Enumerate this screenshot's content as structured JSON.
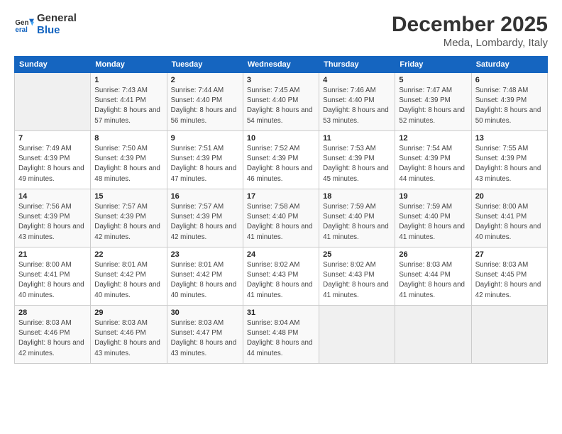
{
  "header": {
    "logo_general": "General",
    "logo_blue": "Blue",
    "month": "December 2025",
    "location": "Meda, Lombardy, Italy"
  },
  "weekdays": [
    "Sunday",
    "Monday",
    "Tuesday",
    "Wednesday",
    "Thursday",
    "Friday",
    "Saturday"
  ],
  "weeks": [
    [
      {
        "day": "",
        "empty": true
      },
      {
        "day": "1",
        "sunrise": "7:43 AM",
        "sunset": "4:41 PM",
        "daylight": "8 hours and 57 minutes."
      },
      {
        "day": "2",
        "sunrise": "7:44 AM",
        "sunset": "4:40 PM",
        "daylight": "8 hours and 56 minutes."
      },
      {
        "day": "3",
        "sunrise": "7:45 AM",
        "sunset": "4:40 PM",
        "daylight": "8 hours and 54 minutes."
      },
      {
        "day": "4",
        "sunrise": "7:46 AM",
        "sunset": "4:40 PM",
        "daylight": "8 hours and 53 minutes."
      },
      {
        "day": "5",
        "sunrise": "7:47 AM",
        "sunset": "4:39 PM",
        "daylight": "8 hours and 52 minutes."
      },
      {
        "day": "6",
        "sunrise": "7:48 AM",
        "sunset": "4:39 PM",
        "daylight": "8 hours and 50 minutes."
      }
    ],
    [
      {
        "day": "7",
        "sunrise": "7:49 AM",
        "sunset": "4:39 PM",
        "daylight": "8 hours and 49 minutes."
      },
      {
        "day": "8",
        "sunrise": "7:50 AM",
        "sunset": "4:39 PM",
        "daylight": "8 hours and 48 minutes."
      },
      {
        "day": "9",
        "sunrise": "7:51 AM",
        "sunset": "4:39 PM",
        "daylight": "8 hours and 47 minutes."
      },
      {
        "day": "10",
        "sunrise": "7:52 AM",
        "sunset": "4:39 PM",
        "daylight": "8 hours and 46 minutes."
      },
      {
        "day": "11",
        "sunrise": "7:53 AM",
        "sunset": "4:39 PM",
        "daylight": "8 hours and 45 minutes."
      },
      {
        "day": "12",
        "sunrise": "7:54 AM",
        "sunset": "4:39 PM",
        "daylight": "8 hours and 44 minutes."
      },
      {
        "day": "13",
        "sunrise": "7:55 AM",
        "sunset": "4:39 PM",
        "daylight": "8 hours and 43 minutes."
      }
    ],
    [
      {
        "day": "14",
        "sunrise": "7:56 AM",
        "sunset": "4:39 PM",
        "daylight": "8 hours and 43 minutes."
      },
      {
        "day": "15",
        "sunrise": "7:57 AM",
        "sunset": "4:39 PM",
        "daylight": "8 hours and 42 minutes."
      },
      {
        "day": "16",
        "sunrise": "7:57 AM",
        "sunset": "4:39 PM",
        "daylight": "8 hours and 42 minutes."
      },
      {
        "day": "17",
        "sunrise": "7:58 AM",
        "sunset": "4:40 PM",
        "daylight": "8 hours and 41 minutes."
      },
      {
        "day": "18",
        "sunrise": "7:59 AM",
        "sunset": "4:40 PM",
        "daylight": "8 hours and 41 minutes."
      },
      {
        "day": "19",
        "sunrise": "7:59 AM",
        "sunset": "4:40 PM",
        "daylight": "8 hours and 41 minutes."
      },
      {
        "day": "20",
        "sunrise": "8:00 AM",
        "sunset": "4:41 PM",
        "daylight": "8 hours and 40 minutes."
      }
    ],
    [
      {
        "day": "21",
        "sunrise": "8:00 AM",
        "sunset": "4:41 PM",
        "daylight": "8 hours and 40 minutes."
      },
      {
        "day": "22",
        "sunrise": "8:01 AM",
        "sunset": "4:42 PM",
        "daylight": "8 hours and 40 minutes."
      },
      {
        "day": "23",
        "sunrise": "8:01 AM",
        "sunset": "4:42 PM",
        "daylight": "8 hours and 40 minutes."
      },
      {
        "day": "24",
        "sunrise": "8:02 AM",
        "sunset": "4:43 PM",
        "daylight": "8 hours and 41 minutes."
      },
      {
        "day": "25",
        "sunrise": "8:02 AM",
        "sunset": "4:43 PM",
        "daylight": "8 hours and 41 minutes."
      },
      {
        "day": "26",
        "sunrise": "8:03 AM",
        "sunset": "4:44 PM",
        "daylight": "8 hours and 41 minutes."
      },
      {
        "day": "27",
        "sunrise": "8:03 AM",
        "sunset": "4:45 PM",
        "daylight": "8 hours and 42 minutes."
      }
    ],
    [
      {
        "day": "28",
        "sunrise": "8:03 AM",
        "sunset": "4:46 PM",
        "daylight": "8 hours and 42 minutes."
      },
      {
        "day": "29",
        "sunrise": "8:03 AM",
        "sunset": "4:46 PM",
        "daylight": "8 hours and 43 minutes."
      },
      {
        "day": "30",
        "sunrise": "8:03 AM",
        "sunset": "4:47 PM",
        "daylight": "8 hours and 43 minutes."
      },
      {
        "day": "31",
        "sunrise": "8:04 AM",
        "sunset": "4:48 PM",
        "daylight": "8 hours and 44 minutes."
      },
      {
        "day": "",
        "empty": true
      },
      {
        "day": "",
        "empty": true
      },
      {
        "day": "",
        "empty": true
      }
    ]
  ]
}
